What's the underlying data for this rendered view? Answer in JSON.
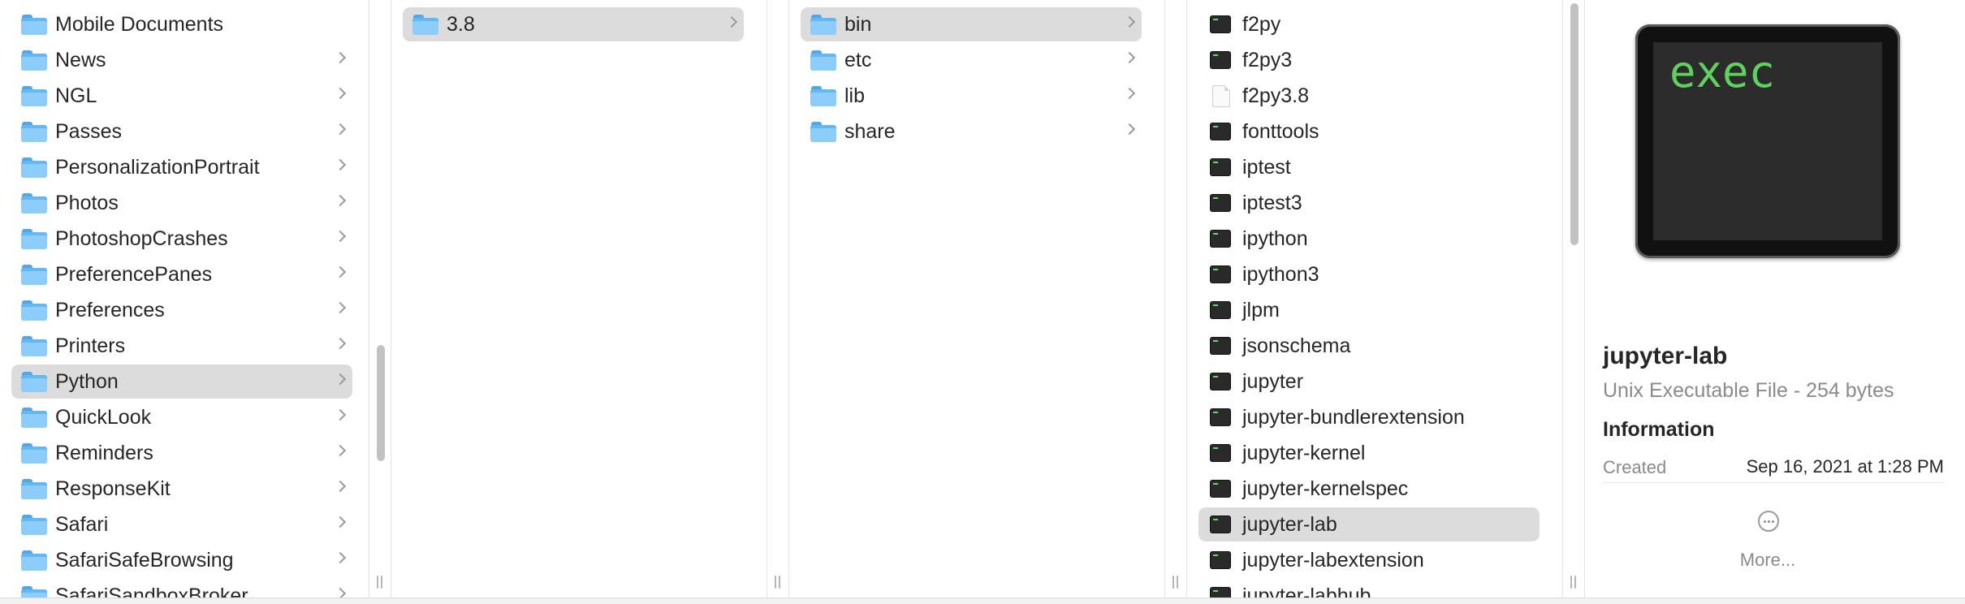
{
  "columns": [
    {
      "items": [
        {
          "label": "Mobile Documents",
          "icon": "folder-icon",
          "chevron": false
        },
        {
          "label": "News",
          "icon": "folder-icon",
          "chevron": true
        },
        {
          "label": "NGL",
          "icon": "folder-icon",
          "chevron": true
        },
        {
          "label": "Passes",
          "icon": "folder-icon",
          "chevron": true
        },
        {
          "label": "PersonalizationPortrait",
          "icon": "folder-icon",
          "chevron": true
        },
        {
          "label": "Photos",
          "icon": "folder-icon",
          "chevron": true
        },
        {
          "label": "PhotoshopCrashes",
          "icon": "folder-icon",
          "chevron": true
        },
        {
          "label": "PreferencePanes",
          "icon": "folder-icon",
          "chevron": true
        },
        {
          "label": "Preferences",
          "icon": "folder-icon",
          "chevron": true
        },
        {
          "label": "Printers",
          "icon": "folder-icon",
          "chevron": true
        },
        {
          "label": "Python",
          "icon": "folder-icon",
          "chevron": true,
          "selected": true
        },
        {
          "label": "QuickLook",
          "icon": "folder-icon",
          "chevron": true
        },
        {
          "label": "Reminders",
          "icon": "folder-icon",
          "chevron": true
        },
        {
          "label": "ResponseKit",
          "icon": "folder-icon",
          "chevron": true
        },
        {
          "label": "Safari",
          "icon": "folder-icon",
          "chevron": true
        },
        {
          "label": "SafariSafeBrowsing",
          "icon": "folder-icon",
          "chevron": true
        },
        {
          "label": "SafariSandboxBroker",
          "icon": "folder-icon",
          "chevron": true
        }
      ]
    },
    {
      "items": [
        {
          "label": "3.8",
          "icon": "folder-icon",
          "chevron": true,
          "selected": true
        }
      ]
    },
    {
      "items": [
        {
          "label": "bin",
          "icon": "folder-icon",
          "chevron": true,
          "selected": true
        },
        {
          "label": "etc",
          "icon": "folder-icon",
          "chevron": true
        },
        {
          "label": "lib",
          "icon": "folder-icon",
          "chevron": true
        },
        {
          "label": "share",
          "icon": "folder-icon",
          "chevron": true
        }
      ]
    },
    {
      "items": [
        {
          "label": "f2py",
          "icon": "exec-icon"
        },
        {
          "label": "f2py3",
          "icon": "exec-icon"
        },
        {
          "label": "f2py3.8",
          "icon": "document-icon"
        },
        {
          "label": "fonttools",
          "icon": "exec-icon"
        },
        {
          "label": "iptest",
          "icon": "exec-icon"
        },
        {
          "label": "iptest3",
          "icon": "exec-icon"
        },
        {
          "label": "ipython",
          "icon": "exec-icon"
        },
        {
          "label": "ipython3",
          "icon": "exec-icon"
        },
        {
          "label": "jlpm",
          "icon": "exec-icon"
        },
        {
          "label": "jsonschema",
          "icon": "exec-icon"
        },
        {
          "label": "jupyter",
          "icon": "exec-icon"
        },
        {
          "label": "jupyter-bundlerextension",
          "icon": "exec-icon"
        },
        {
          "label": "jupyter-kernel",
          "icon": "exec-icon"
        },
        {
          "label": "jupyter-kernelspec",
          "icon": "exec-icon"
        },
        {
          "label": "jupyter-lab",
          "icon": "exec-icon",
          "selected": true
        },
        {
          "label": "jupyter-labextension",
          "icon": "exec-icon"
        },
        {
          "label": "jupyter-labhub",
          "icon": "exec-icon"
        }
      ]
    }
  ],
  "preview": {
    "icon_text": "exec",
    "name": "jupyter-lab",
    "kind": "Unix Executable File - 254 bytes",
    "section_title": "Information",
    "created_label": "Created",
    "created_value": "Sep 16, 2021 at 1:28 PM",
    "more_label": "More..."
  },
  "colors": {
    "selection": "#dcdcdc",
    "folder": "#64b7f3",
    "exec_text": "#5dd35d"
  }
}
